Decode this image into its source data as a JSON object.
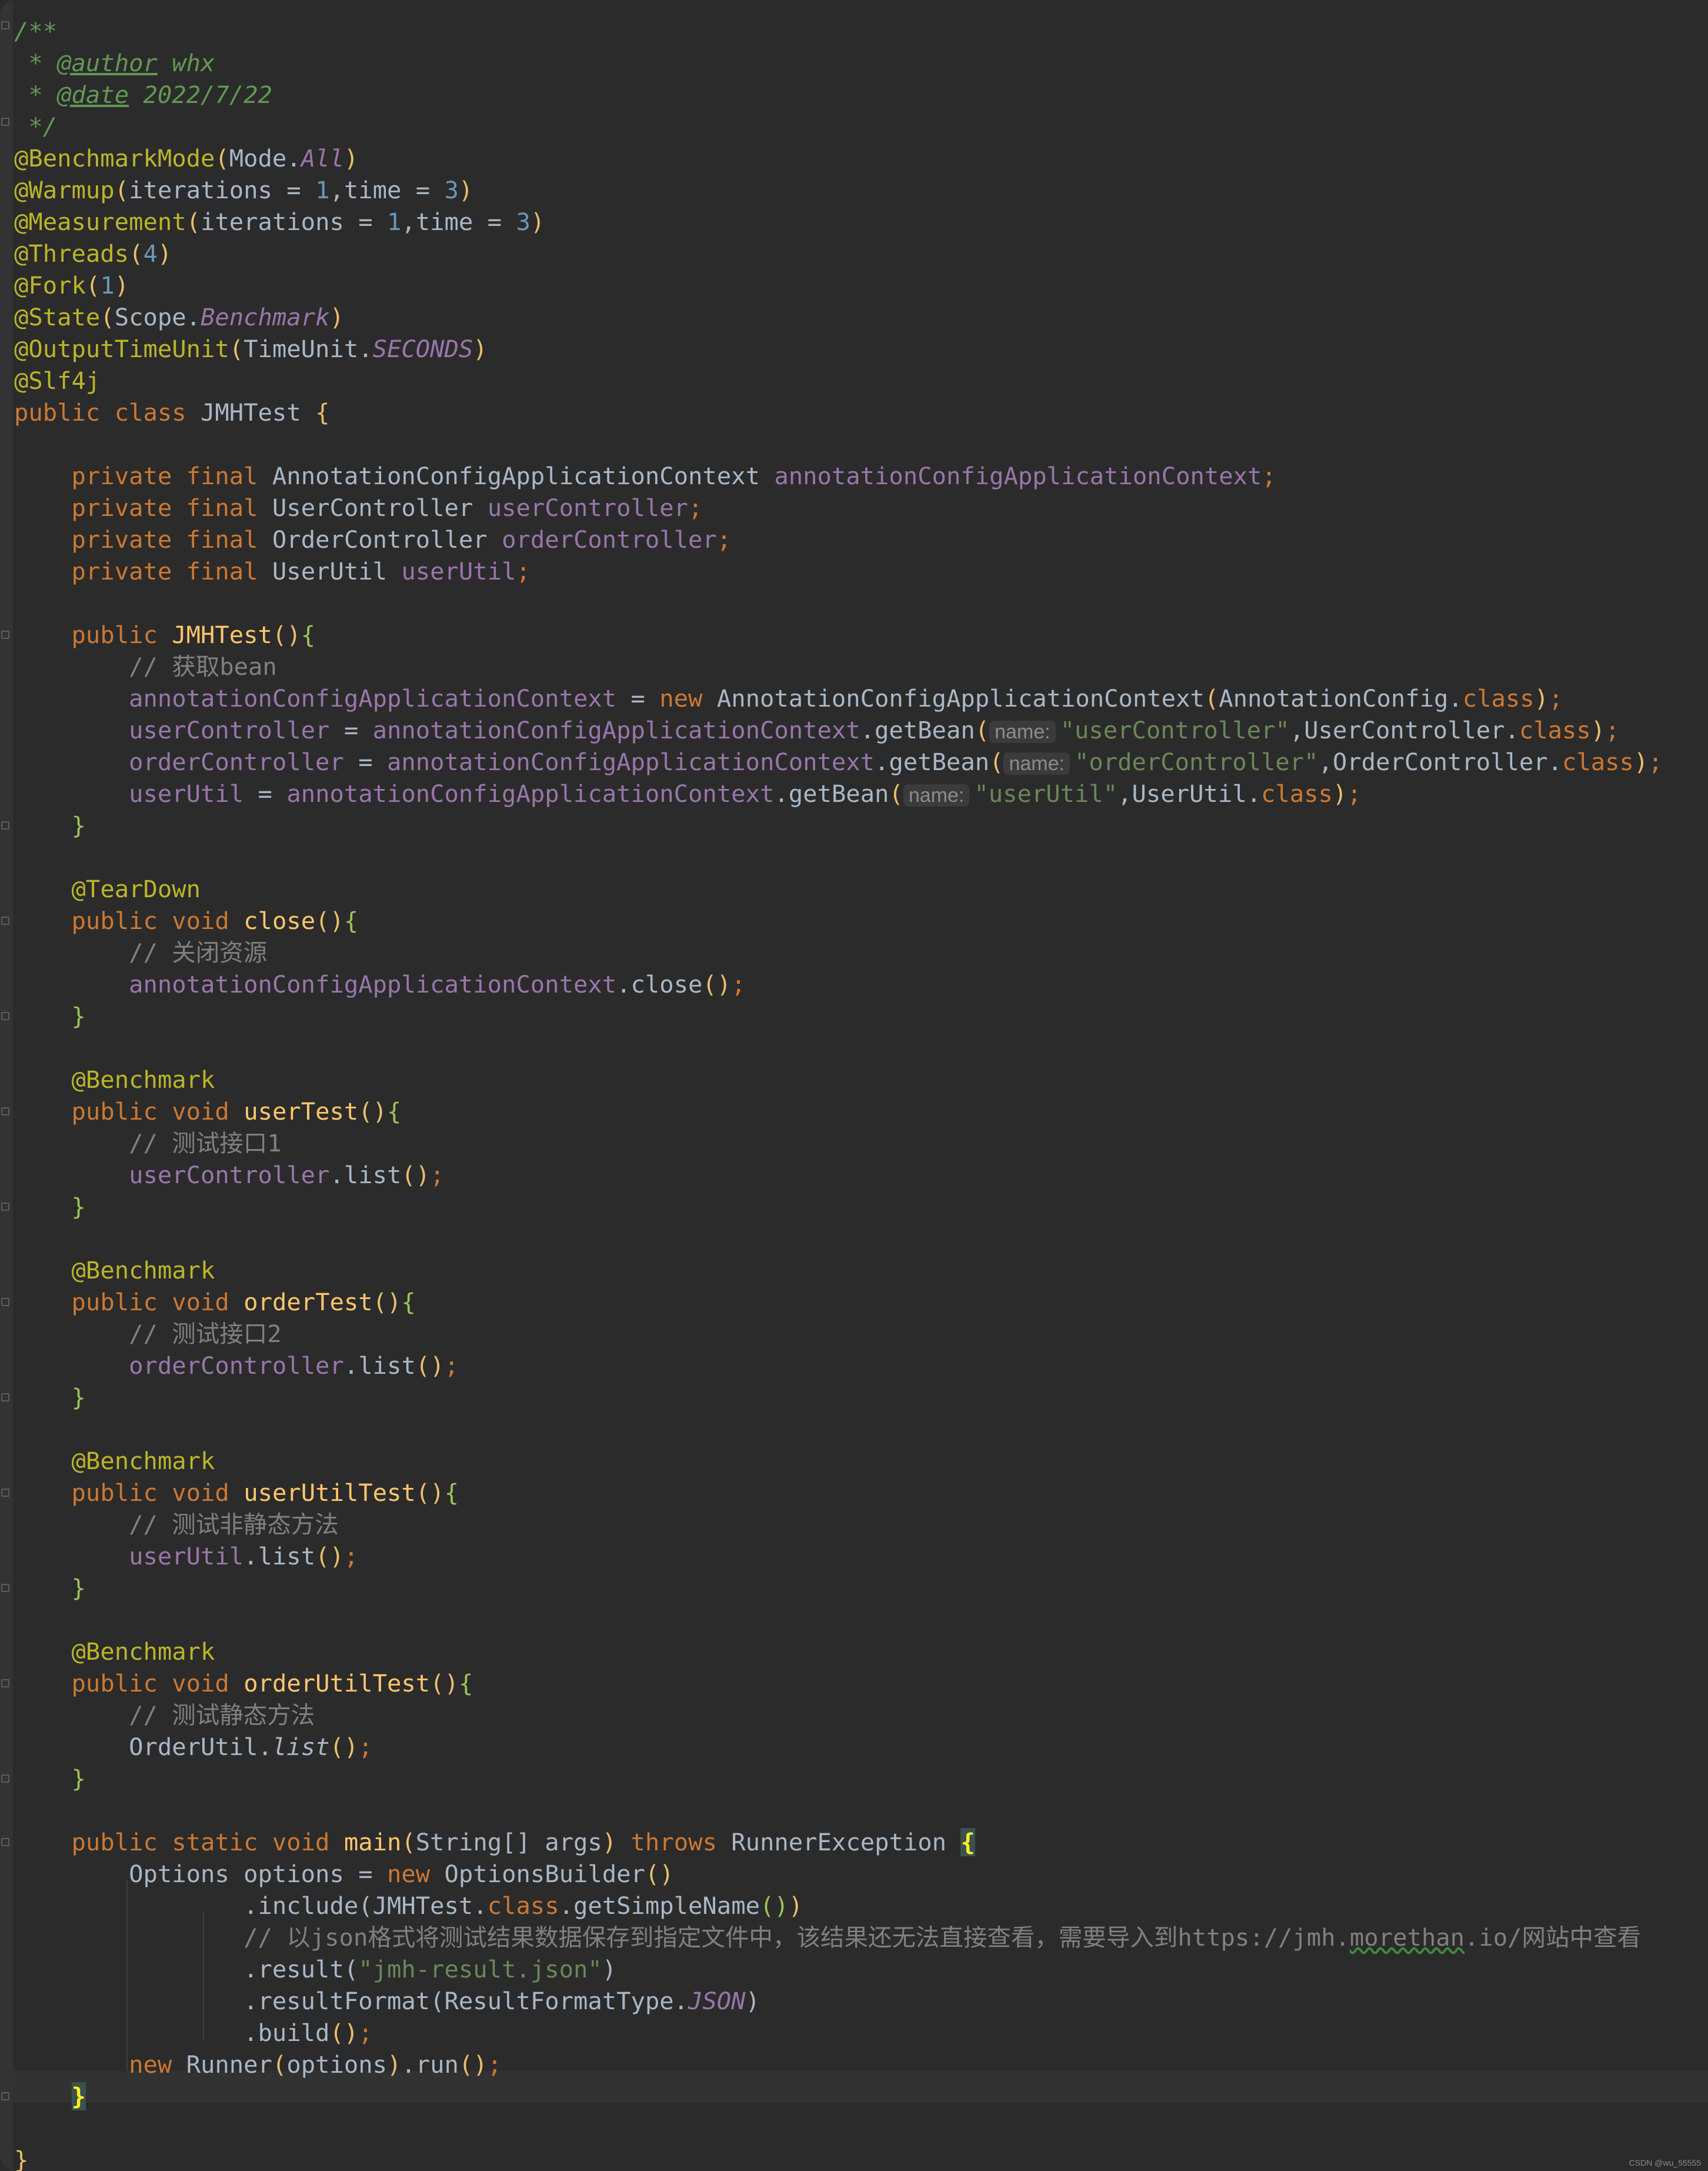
{
  "editor": {
    "language": "Java",
    "theme_colors": {
      "background": "#2b2b2b",
      "keyword": "#cc7832",
      "annotation": "#bbb529",
      "comment": "#808080",
      "field": "#9876aa",
      "number": "#6897bb",
      "string": "#6a8759",
      "method": "#ffc66d"
    }
  },
  "code": {
    "doc_open": "/**",
    "doc_star": " * ",
    "author_tag": "@author",
    "author_value": " whx",
    "date_tag": "@date",
    "date_value": " 2022/7/22",
    "doc_close": " */",
    "ann_benchmark_mode": "@BenchmarkMode",
    "mode_cls": "Mode.",
    "mode_all": "All",
    "ann_warmup": "@Warmup",
    "warmup_args_a": "iterations = ",
    "warmup_iter": "1",
    "warmup_args_b": ",time = ",
    "warmup_time": "3",
    "ann_measurement": "@Measurement",
    "meas_iter": "1",
    "meas_time": "3",
    "ann_threads": "@Threads",
    "threads_n": "4",
    "ann_fork": "@Fork",
    "fork_n": "1",
    "ann_state": "@State",
    "scope_cls": "Scope.",
    "scope_benchmark": "Benchmark",
    "ann_output_time_unit": "@OutputTimeUnit",
    "timeunit_cls": "TimeUnit.",
    "timeunit_seconds": "SECONDS",
    "ann_slf4j": "@Slf4j",
    "kw_public": "public",
    "kw_class": "class",
    "class_name": "JMHTest",
    "kw_private_final": "private final",
    "type_acac": "AnnotationConfigApplicationContext",
    "f_acac": "annotationConfigApplicationContext",
    "type_uc": "UserController",
    "f_uc": "userController",
    "type_oc": "OrderController",
    "f_oc": "orderController",
    "type_uu": "UserUtil",
    "f_uu": "userUtil",
    "ctor_name": "JMHTest",
    "cmt_get_bean": "// 获取bean",
    "kw_new": "new",
    "acac_arg_cls": "AnnotationConfig.",
    "kw_class_ref": "class",
    "get_bean": ".getBean",
    "hint_name": "name:",
    "str_uc": "\"userController\"",
    "uc_cls": ",UserController.",
    "str_oc": "\"orderController\"",
    "oc_cls": ",OrderController.",
    "str_uu": "\"userUtil\"",
    "uu_cls": ",UserUtil.",
    "ann_teardown": "@TearDown",
    "kw_void": "void",
    "m_close": "close",
    "cmt_close": "// 关闭资源",
    "close_call": ".close",
    "ann_benchmark": "@Benchmark",
    "m_user_test": "userTest",
    "cmt_api1": "// 测试接口1",
    "list_call": ".list",
    "m_order_test": "orderTest",
    "cmt_api2": "// 测试接口2",
    "m_user_util_test": "userUtilTest",
    "cmt_nonstatic": "// 测试非静态方法",
    "m_order_util_test": "orderUtilTest",
    "cmt_static": "// 测试静态方法",
    "order_util_cls": "OrderUtil.",
    "list_name": "list",
    "kw_public_static_void": "public static void",
    "m_main": "main",
    "main_param": "String[] args",
    "kw_throws": "throws",
    "exc_name": "RunnerException",
    "opt_decl": "Options options = ",
    "ob_name": "OptionsBuilder",
    "include_call": ".include(",
    "jmh_test_cls": "JMHTest.",
    "get_simple_name": ".getSimpleName",
    "cmt_json_a": "// 以json格式将测试结果数据保存到指定文件中，该结果还无法直接查看，需要导入到https://jmh.",
    "cmt_json_b": "morethan",
    "cmt_json_c": ".io/网站中查看",
    "result_call": ".result(",
    "str_result_file": "\"jmh-result.json\"",
    "result_format_call": ".resultFormat(",
    "rft_cls": "ResultFormatType.",
    "rft_json": "JSON",
    "build_call": ".build",
    "runner_name": "Runner",
    "options_var": "options",
    "run_call": ".run",
    "brace_open": "{",
    "brace_close": "}",
    "paren_open": "(",
    "paren_close": ")",
    "parens": "()",
    "semi": ";",
    "end_call": "();",
    "assign": " = ",
    "dot": "."
  },
  "watermark": "CSDN @wu_55555"
}
